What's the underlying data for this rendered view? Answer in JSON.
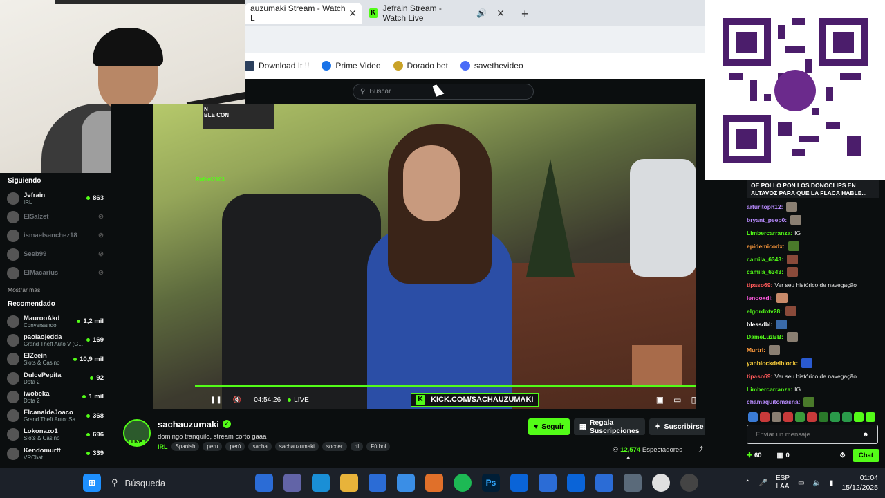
{
  "browser": {
    "tabs": [
      {
        "label": "sachauzumaki Stream - Watch Live on Kick",
        "display": "auzumaki Stream - Watch L"
      },
      {
        "label": "Jefrain Stream - Watch Live",
        "display": "Jefrain Stream - Watch Live"
      }
    ],
    "new_tab": "+",
    "bookmarks": [
      "Download It !!",
      "Prime Video",
      "Dorado bet",
      "savethevideo"
    ]
  },
  "kick": {
    "search_placeholder": "Buscar",
    "sidebar": {
      "following_header": "Siguiendo",
      "following": [
        {
          "name": "Jefrain",
          "category": "IRL",
          "viewers": "863",
          "online": true
        },
        {
          "name": "ElSalzet",
          "category": "",
          "viewers": "",
          "online": false
        },
        {
          "name": "ismaelsanchez18",
          "category": "",
          "viewers": "",
          "online": false
        },
        {
          "name": "Seeb99",
          "category": "",
          "viewers": "",
          "online": false
        },
        {
          "name": "ElMacarius",
          "category": "",
          "viewers": "",
          "online": false
        }
      ],
      "show_more": "Mostrar más",
      "recommended_header": "Recomendado",
      "recommended": [
        {
          "name": "MaurooAkd",
          "category": "Conversando",
          "viewers": "1,2 mil"
        },
        {
          "name": "paolaojedda",
          "category": "Grand Theft Auto V (G...",
          "viewers": "169"
        },
        {
          "name": "ElZeein",
          "category": "Slots & Casino",
          "viewers": "10,9 mil"
        },
        {
          "name": "DulcePepita",
          "category": "Dota 2",
          "viewers": "92"
        },
        {
          "name": "iwobeka",
          "category": "Dota 2",
          "viewers": "1 mil"
        },
        {
          "name": "ElcanaldeJoaco",
          "category": "Grand Theft Auto: Sa...",
          "viewers": "368"
        },
        {
          "name": "Lokonazo1",
          "category": "Slots & Casino",
          "viewers": "696"
        },
        {
          "name": "Kendomurft",
          "category": "VRChat",
          "viewers": "339"
        }
      ]
    },
    "player": {
      "time": "04:54:26",
      "live_label": "LIVE",
      "kick_url": "KICK.COM/SACHAUZUMAKI",
      "overlay_badge": "N\nBLE CON",
      "overlay_chat": [
        "Rafael2103",
        "",
        "",
        ""
      ]
    },
    "stream": {
      "streamer": "sachauzumaki",
      "live_tag": "LIVE",
      "title": "domingo tranquilo, stream corto gaaa",
      "category": "IRL",
      "tags": [
        "Spanish",
        "peru",
        "perú",
        "sacha",
        "sachauzumaki",
        "soccer",
        "rtl",
        "Fútbol"
      ],
      "follow": "Seguir",
      "gift_subs": "Regala Suscripciones",
      "subscribe": "Suscribirse",
      "viewers": "12,574",
      "viewers_label": "Espectadores"
    },
    "chat": {
      "pinned": "OE POLLO PON LOS DONOCLIPS EN ALTAVOZ PARA QUE LA FLACA HABLE...",
      "messages": [
        {
          "user": "arturitoph12:",
          "text": "",
          "color": "#b98cff",
          "emote": "#8a7f72"
        },
        {
          "user": "bryant_peep0:",
          "text": "",
          "color": "#b98cff",
          "emote": "#8a7f72"
        },
        {
          "user": "Limbercarranza:",
          "text": "IG",
          "color": "#53fc18",
          "emote": ""
        },
        {
          "user": "epidemicodx:",
          "text": "",
          "color": "#ff9a3c",
          "emote": "#4a7a2a"
        },
        {
          "user": "camila_6343:",
          "text": "",
          "color": "#53fc18",
          "emote": "#8a4a3a"
        },
        {
          "user": "camila_6343:",
          "text": "",
          "color": "#53fc18",
          "emote": "#8a4a3a"
        },
        {
          "user": "tipaso69:",
          "text": "Ver seu histórico de navegação",
          "color": "#ff5a5a",
          "emote": ""
        },
        {
          "user": "lenooxdi:",
          "text": "",
          "color": "#ff5ae0",
          "emote": "#c88a6a"
        },
        {
          "user": "elgordotv28:",
          "text": "",
          "color": "#53fc18",
          "emote": "#8a4a3a"
        },
        {
          "user": "blessdbl:",
          "text": "",
          "color": "#ffffff",
          "emote": "#3a6aa8"
        },
        {
          "user": "DameLuzBB:",
          "text": "",
          "color": "#53fc18",
          "emote": "#8a7f72"
        },
        {
          "user": "Murtri:",
          "text": "",
          "color": "#ff9a3c",
          "emote": "#8a7f72"
        },
        {
          "user": "yanblockdelblock:",
          "text": "",
          "color": "#ffd23c",
          "emote": "#2a5ad0"
        },
        {
          "user": "tipaso69:",
          "text": "Ver seu histórico de navegação",
          "color": "#ff5a5a",
          "emote": ""
        },
        {
          "user": "Limbercarranza:",
          "text": "IG",
          "color": "#53fc18",
          "emote": ""
        },
        {
          "user": "chamaquitomasna:",
          "text": "",
          "color": "#b98cff",
          "emote": "#4a7a2a"
        }
      ],
      "input_placeholder": "Enviar un mensaje",
      "points": "60",
      "subs_count": "0",
      "chat_button": "Chat"
    }
  },
  "taskbar": {
    "search_label": "Búsqueda",
    "language": "ESP",
    "layout": "LAA",
    "time": "01:04",
    "date": "15/12/2025"
  },
  "colors": {
    "kick_green": "#53fc18",
    "bg": "#0b0e0f"
  }
}
